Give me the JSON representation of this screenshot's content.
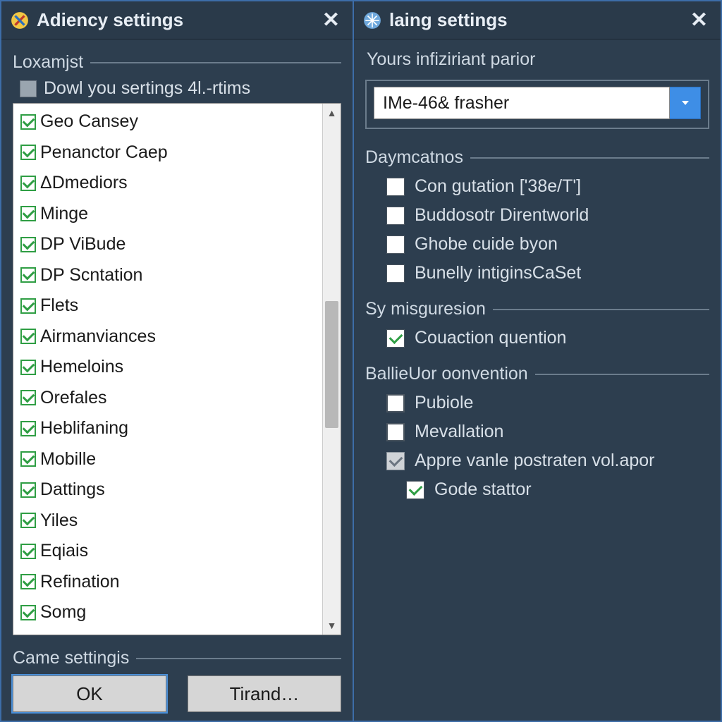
{
  "left": {
    "title": "Adiency settings",
    "group_label": "Loxamjst",
    "sub_label": "Dowl you sertings 4l.-rtims",
    "items": [
      "Geo Cansey",
      "Penanctor Caep",
      "ΔDmediors",
      "Minge",
      "DP ViBude",
      "DP Scntation",
      "Flets",
      "Airmanviances",
      "Hemeloins",
      "Orefales",
      "Heblifaning",
      "Mobille",
      "Dattings",
      "Yiles",
      "Eqiais",
      "Refination",
      "Somg"
    ],
    "bottom_group": "Came settingis",
    "ok_label": "OK",
    "cancel_label": "Tirand…"
  },
  "right": {
    "title": "laing settings",
    "field_label": "Yours infiziriant parior",
    "combo_value": "IMe-46& frasher",
    "group_daym": "Daymcatnos",
    "daym_items": [
      {
        "label": "Con gutation ['38e/T']",
        "checked": false,
        "style": "plain"
      },
      {
        "label": "Buddosotr Direntworld",
        "checked": false,
        "style": "plain"
      },
      {
        "label": "Ghobe cuide byon",
        "checked": false,
        "style": "plain"
      },
      {
        "label": "Bunelly intiginsCaSet",
        "checked": false,
        "style": "plain"
      }
    ],
    "group_sy": "Sy misguresion",
    "sy_items": [
      {
        "label": "Couaction quention",
        "checked": true,
        "style": "green"
      }
    ],
    "group_ball": "BallieUor oonvention",
    "ball_items": [
      {
        "label": "Pubiole",
        "checked": false,
        "style": "dark"
      },
      {
        "label": "Mevallation",
        "checked": false,
        "style": "dark"
      },
      {
        "label": "Appre vanle postraten vol.apor",
        "checked": true,
        "style": "grey-tri",
        "indent": 1
      },
      {
        "label": "Gode stattor",
        "checked": true,
        "style": "green",
        "indent": 2
      }
    ]
  }
}
